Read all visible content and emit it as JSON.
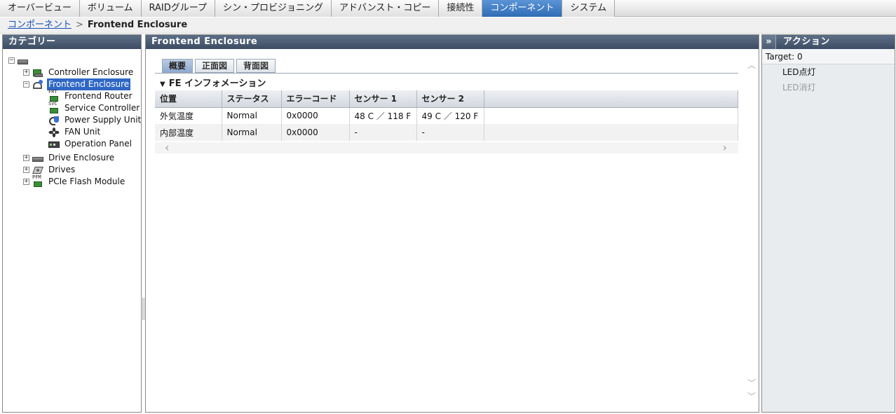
{
  "top_tabs": [
    {
      "label": "オーバービュー"
    },
    {
      "label": "ボリューム"
    },
    {
      "label": "RAIDグループ"
    },
    {
      "label": "シン・プロビジョニング"
    },
    {
      "label": "アドバンスト・コピー"
    },
    {
      "label": "接続性"
    },
    {
      "label": "コンポーネント",
      "active": true
    },
    {
      "label": "システム"
    }
  ],
  "breadcrumb": {
    "link": "コンポーネント",
    "separator": ">",
    "current": "Frontend Enclosure"
  },
  "category_panel": {
    "title": "カテゴリー",
    "tree": {
      "root_expander": "−",
      "items": [
        {
          "label": "Controller Enclosure",
          "expander": "+",
          "icon": "controller-enclosure-icon"
        },
        {
          "label": "Frontend Enclosure",
          "expander": "−",
          "icon": "frontend-enclosure-icon",
          "selected": true
        },
        {
          "label": "Frontend Router",
          "icon": "frontend-router-icon",
          "icon_text": "FRT"
        },
        {
          "label": "Service Controller",
          "icon": "service-controller-icon",
          "icon_text": "SVC"
        },
        {
          "label": "Power Supply Unit",
          "icon": "power-supply-icon"
        },
        {
          "label": "FAN Unit",
          "icon": "fan-icon"
        },
        {
          "label": "Operation Panel",
          "icon": "operation-panel-icon"
        },
        {
          "label": "Drive Enclosure",
          "expander": "+",
          "icon": "drive-enclosure-icon"
        },
        {
          "label": "Drives",
          "expander": "+",
          "icon": "drive-icon"
        },
        {
          "label": "PCIe Flash Module",
          "expander": "+",
          "icon": "pcie-flash-icon",
          "icon_text": "PFM"
        }
      ]
    }
  },
  "main_panel": {
    "title": "Frontend Enclosure",
    "tabs": [
      {
        "label": "概要",
        "active": true
      },
      {
        "label": "正面図"
      },
      {
        "label": "背面図"
      }
    ],
    "section": {
      "triangle": "▼",
      "title": "FE インフォメーション"
    },
    "table": {
      "columns": [
        "位置",
        "ステータス",
        "エラーコード",
        "センサー 1",
        "センサー 2"
      ],
      "rows": [
        [
          "外気温度",
          "Normal",
          "0x0000",
          "48 C ／ 118 F",
          "49 C ／ 120 F"
        ],
        [
          "内部温度",
          "Normal",
          "0x0000",
          "-",
          "-"
        ]
      ]
    }
  },
  "action_panel": {
    "collapse_glyph": "»",
    "title": "アクション",
    "target_label": "Target:",
    "target_value": "0",
    "actions": [
      {
        "label": "LED点灯",
        "enabled": true
      },
      {
        "label": "LED消灯",
        "enabled": false
      }
    ]
  },
  "colors": {
    "header_bg": "#4a5b72",
    "active_tab": "#3a78c2",
    "selection": "#2f68c4",
    "link": "#1a4fb5"
  }
}
